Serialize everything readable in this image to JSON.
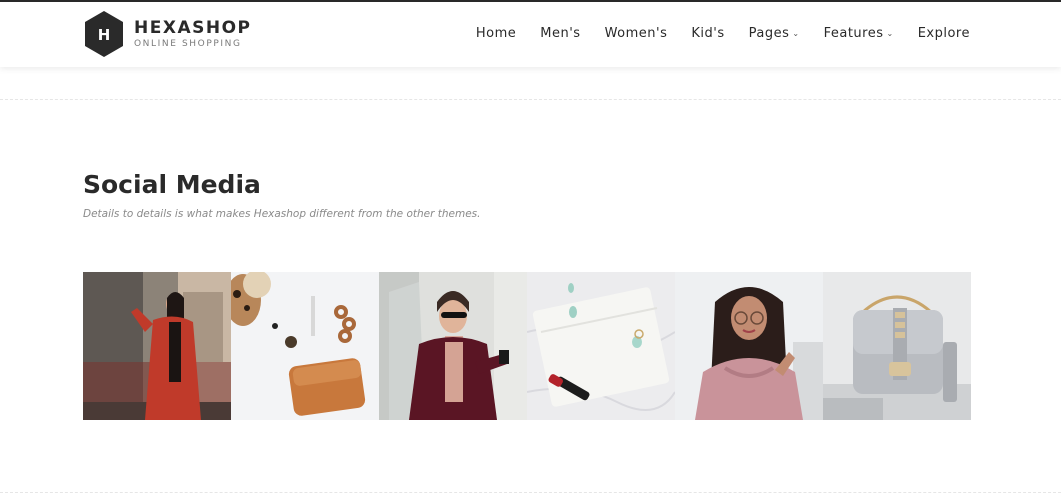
{
  "brand": {
    "logo_letter": "H",
    "name": "HEXASHOP",
    "tagline": "ONLINE SHOPPING"
  },
  "nav": [
    {
      "label": "Home",
      "dropdown": false
    },
    {
      "label": "Men's",
      "dropdown": false
    },
    {
      "label": "Women's",
      "dropdown": false
    },
    {
      "label": "Kid's",
      "dropdown": false
    },
    {
      "label": "Pages",
      "dropdown": true
    },
    {
      "label": "Features",
      "dropdown": true
    },
    {
      "label": "Explore",
      "dropdown": false
    }
  ],
  "section": {
    "title": "Social Media",
    "subtitle": "Details to details is what makes Hexashop different from the other themes."
  },
  "gallery": [
    {
      "name": "red-coat-woman-photo"
    },
    {
      "name": "wallet-accessories-photo"
    },
    {
      "name": "burgundy-coat-woman-photo"
    },
    {
      "name": "white-clutch-lipstick-photo"
    },
    {
      "name": "pink-blouse-woman-photo"
    },
    {
      "name": "grey-handbag-photo"
    }
  ],
  "colors": {
    "text_dark": "#2a2a2a",
    "text_muted": "#8a8a8a",
    "logo_hex": "#2a2a2a"
  }
}
